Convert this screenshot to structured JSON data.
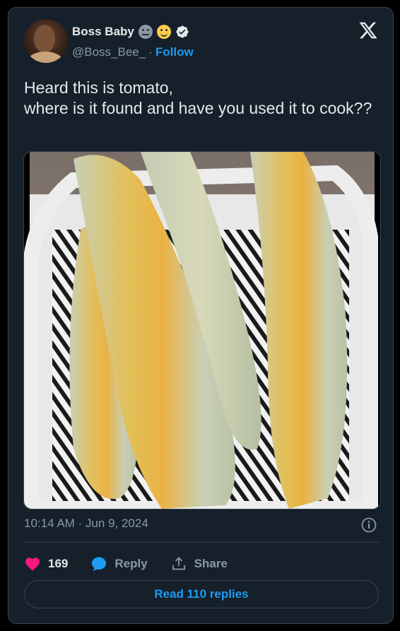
{
  "author": {
    "display_name": "Boss Baby",
    "handle": "@Boss_Bee_",
    "separator": "·",
    "follow_label": "Follow",
    "badges": [
      "neutral-face-emoji",
      "smiling-face-emoji",
      "verified-badge"
    ]
  },
  "tweet": {
    "text": "Heard this is tomato,\nwhere is it found and have you used it to cook??",
    "image_alt": "photo",
    "timestamp": "10:14 AM · Jun 9, 2024"
  },
  "actions": {
    "likes": "169",
    "reply_label": "Reply",
    "share_label": "Share"
  },
  "read_replies_label": "Read 110 replies",
  "colors": {
    "background": "#15202b",
    "border": "#38444d",
    "accent": "#1d9bf0",
    "like": "#f91880",
    "reply_icon": "#1d9bf0",
    "text": "#e7e9ea",
    "muted": "#8b98a5"
  },
  "icons": [
    "x-logo-icon",
    "info-icon",
    "heart-icon",
    "reply-bubble-icon",
    "share-icon"
  ]
}
